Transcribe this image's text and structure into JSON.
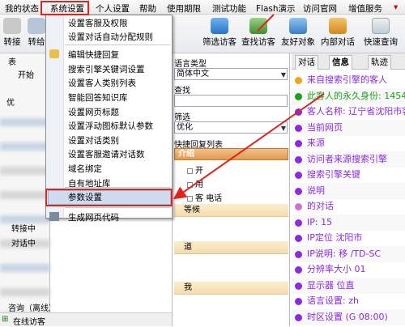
{
  "menubar": {
    "items": [
      "我的状态",
      "系统设置",
      "个人设置",
      "帮助",
      "使用期限",
      "测试功能",
      "Flash演示",
      "访问官网",
      "增值服务"
    ],
    "active": "系统设置"
  },
  "toolbar": {
    "buttons": [
      {
        "label": "转接",
        "icon": "transfer-icon"
      },
      {
        "label": "转给",
        "icon": "forward-icon"
      },
      {
        "label": "筛选访客",
        "icon": "filter-visitor-icon"
      },
      {
        "label": "查找访客",
        "icon": "find-visitor-icon"
      },
      {
        "label": "友好对象",
        "icon": "friend-icon"
      },
      {
        "label": "内部对话",
        "icon": "internal-chat-icon"
      },
      {
        "label": "快速查询",
        "icon": "quick-search-icon"
      }
    ]
  },
  "system_menu": {
    "items": [
      "设置客服及权限",
      "设置对话自动分配规则",
      "编辑快捷回复",
      "搜索引擎关键词设置",
      "设置客人类别列表",
      "智能回答知识库",
      "设置网页标题",
      "设置浮动图标默认参数",
      "设置对话类别",
      "设置客服邀请对话数",
      "域名绑定",
      "自有地址库",
      "参数设置",
      "生成网页代码"
    ],
    "highlighted": "参数设置"
  },
  "left_tree": {
    "rows": [
      "表",
      "开始",
      "优",
      "",
      "",
      "",
      "",
      "",
      "",
      "",
      "",
      "",
      "",
      "转接中",
      "对话中",
      "",
      "",
      "",
      "",
      "",
      "咨询（离线）",
      "在线访客"
    ]
  },
  "middle": {
    "language_label": "语言类型",
    "language_value": "简体中文",
    "find_label": "查找",
    "filter_label": "筛选",
    "filter_value": "优化",
    "quick_reply_label": "快捷回复列表",
    "quick_reply_header": "介绍",
    "groups": [
      {
        "label": "等候",
        "items": []
      },
      {
        "label": "道",
        "items": []
      },
      {
        "label": "我",
        "items": []
      }
    ],
    "items": [
      "开",
      "用",
      "客",
      "电话"
    ]
  },
  "right": {
    "tabs": [
      "对话",
      "信息",
      "轨迹"
    ],
    "active_tab": "信息",
    "rows": [
      {
        "text": "来自搜索引擎的客人",
        "color": "#8a2be2",
        "bullet": "#f2a21b"
      },
      {
        "text": "此客人的永久身份: 1454",
        "color": "#1aa01a",
        "bullet": "#1aa01a"
      },
      {
        "text": "客人名称: 辽宁省沈阳市客",
        "color": "#8a2be2",
        "bullet": "#8a2be2"
      },
      {
        "text": "当前网页",
        "color": "#8a2be2",
        "bullet": "#8a2be2"
      },
      {
        "text": "来源",
        "color": "#8a2be2",
        "bullet": "#8a2be2"
      },
      {
        "text": "访问者来源搜索引擎",
        "color": "#8a2be2",
        "bullet": "#8a2be2"
      },
      {
        "text": "搜索引擎关键",
        "color": "#8a2be2",
        "bullet": "#8a2be2"
      },
      {
        "text": "说明",
        "color": "#8a2be2",
        "bullet": "#8a2be2"
      },
      {
        "text": "的对话",
        "color": "#8a2be2",
        "bullet": "#d070d0"
      },
      {
        "text": "IP: 15",
        "color": "#8a2be2",
        "bullet": "#8a2be2"
      },
      {
        "text": "IP定位 沈阳市",
        "color": "#8a2be2",
        "bullet": "#8a2be2"
      },
      {
        "text": "IP说明: 移 /TD-SC",
        "color": "#8a2be2",
        "bullet": "#8a2be2"
      },
      {
        "text": "分辨率大小 01",
        "color": "#8a2be2",
        "bullet": "#8a2be2"
      },
      {
        "text": "显示器 位直",
        "color": "#8a2be2",
        "bullet": "#8a2be2"
      },
      {
        "text": "语言设置: zh",
        "color": "#8a2be2",
        "bullet": "#8a2be2"
      },
      {
        "text": "时区设置 (G 08:00)",
        "color": "#8a2be2",
        "bullet": "#8a2be2"
      }
    ]
  }
}
